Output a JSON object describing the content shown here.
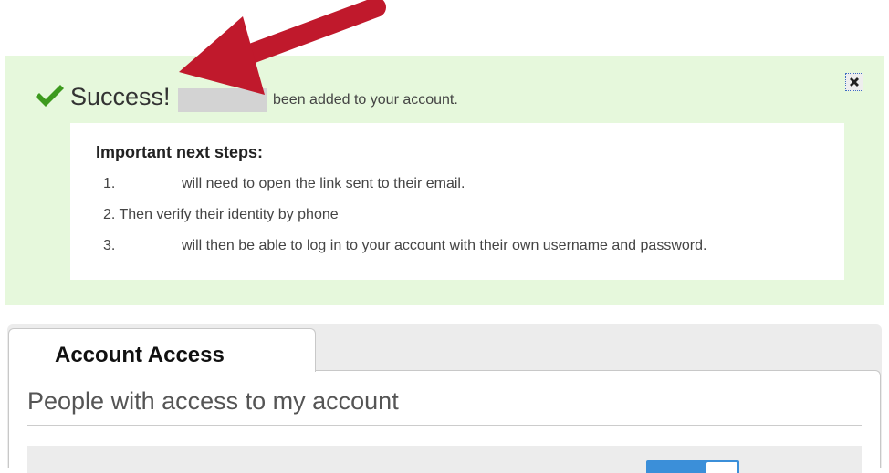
{
  "alert": {
    "title": "Success!",
    "message": "been added to your account.",
    "close_label": "Close"
  },
  "next_steps": {
    "heading": "Important next steps:",
    "steps": [
      {
        "number": "1.",
        "text": "will need to open the link sent to their email."
      },
      {
        "number": "2.",
        "text": "Then verify their identity by phone"
      },
      {
        "number": "3.",
        "text": "will then be able to log in to your account with their own username and password."
      }
    ]
  },
  "account": {
    "tab_label": "Account Access",
    "section_heading": "People with access to my account"
  },
  "colors": {
    "success_bg": "#e6f8dc",
    "check_green": "#3d9a1e",
    "annotation_arrow": "#c0192c",
    "toggle_blue": "#3b8fd9"
  }
}
